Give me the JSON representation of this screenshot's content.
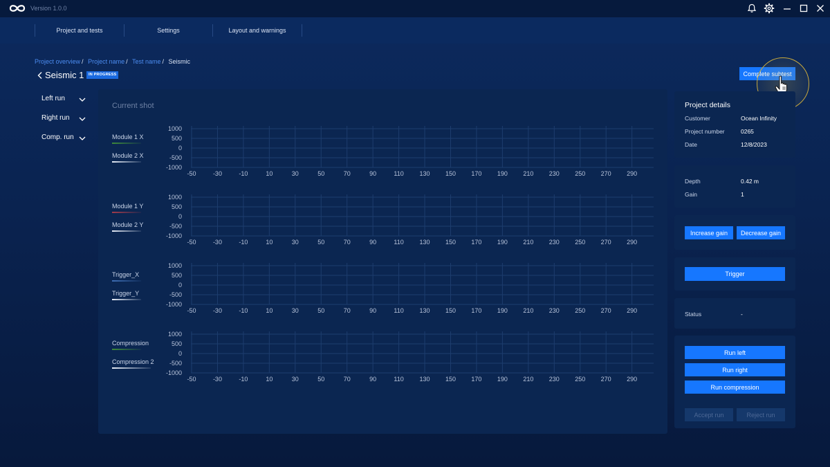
{
  "app": {
    "version": "Version 1.0.0"
  },
  "nav": {
    "tabs": [
      "Project and tests",
      "Settings",
      "Layout and warnings"
    ]
  },
  "breadcrumb": [
    "Project overview",
    "Project name",
    "Test name",
    "Seismic"
  ],
  "header": {
    "title": "Seismic 1",
    "status": "IN PROGRESS",
    "complete_label": "Complete subtest"
  },
  "left_panel": {
    "items": [
      "Left run",
      "Right run",
      "Comp. run"
    ]
  },
  "center": {
    "title": "Current shot",
    "charts": [
      {
        "legend": [
          {
            "label": "Module 1 X",
            "color": "#3f8a3a"
          },
          {
            "label": "Module 2 X",
            "color": "#e8eef8"
          }
        ]
      },
      {
        "legend": [
          {
            "label": "Module 1 Y",
            "color": "#a33b4a"
          },
          {
            "label": "Module 2 Y",
            "color": "#e8eef8"
          }
        ]
      },
      {
        "legend": [
          {
            "label": "Trigger_X",
            "color": "#3f6fb5"
          },
          {
            "label": "Trigger_Y",
            "color": "#e8eef8"
          }
        ]
      },
      {
        "legend": [
          {
            "label": "Compression",
            "color": "#3f8a3a"
          },
          {
            "label": "Compression 2",
            "color": "#e8eef8"
          }
        ]
      }
    ],
    "y_ticks": [
      "1000",
      "500",
      "0",
      "-500",
      "-1000"
    ],
    "x_ticks": [
      "-50",
      "-30",
      "-10",
      "10",
      "30",
      "50",
      "70",
      "90",
      "110",
      "130",
      "150",
      "170",
      "190",
      "210",
      "230",
      "250",
      "270",
      "290"
    ]
  },
  "details": {
    "title": "Project details",
    "rows": [
      {
        "label": "Customer",
        "value": "Ocean Infinity"
      },
      {
        "label": "Project number",
        "value": "0265"
      },
      {
        "label": "Date",
        "value": "12/8/2023"
      }
    ]
  },
  "params": {
    "rows": [
      {
        "label": "Depth",
        "value": "0.42 m"
      },
      {
        "label": "Gain",
        "value": "1"
      }
    ]
  },
  "gain": {
    "increase": "Increase gain",
    "decrease": "Decrease gain"
  },
  "trigger": {
    "label": "Trigger"
  },
  "status": {
    "label": "Status",
    "value": "-"
  },
  "runs": {
    "left": "Run left",
    "right": "Run right",
    "compression": "Run compression",
    "accept": "Accept run",
    "reject": "Reject run"
  },
  "colors": {
    "accent": "#1677ff",
    "link": "#4c8cf0",
    "badge": "#1a6ae0",
    "cursor_ring": "#c9a93c"
  }
}
